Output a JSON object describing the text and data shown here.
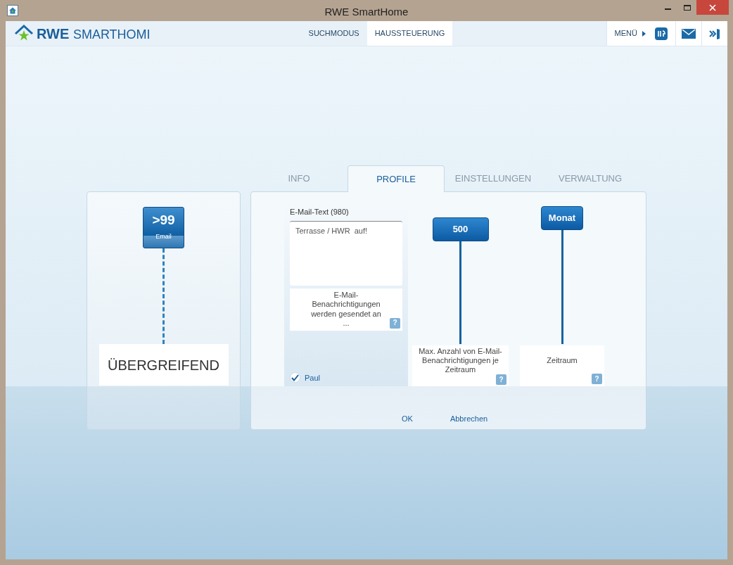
{
  "window": {
    "title": "RWE SmartHome"
  },
  "header": {
    "logo_text": {
      "bold": "RWE",
      "light": "SMARTHOMI"
    },
    "nav": [
      {
        "label": "SUCHMODUS",
        "selected": false
      },
      {
        "label": "HAUSSTEUERUNG",
        "selected": true
      }
    ],
    "menu_label": "MENÜ"
  },
  "scope_panel": {
    "badge_value": ">99",
    "badge_label": "Email",
    "scope": "ÜBERGREIFEND"
  },
  "tabs": [
    {
      "label": "INFO",
      "selected": false
    },
    {
      "label": "PROFILE",
      "selected": true
    },
    {
      "label": "EINSTELLUNGEN",
      "selected": false
    },
    {
      "label": "VERWALTUNG",
      "selected": false
    }
  ],
  "profile": {
    "email_text_label": "E-Mail-Text (980)",
    "email_text_value": "Terrasse / HWR  auf!",
    "recipients_info": {
      "text": "E-Mail-Benachrichtigungen werden gesendet an ...",
      "help": "?"
    },
    "recipients": [
      {
        "name": "Paul",
        "checked": true
      }
    ],
    "settings": [
      {
        "value": "500",
        "label": "Max. Anzahl von E-Mail-Benachrichtigungen je Zeitraum",
        "help": "?"
      },
      {
        "value": "Monat",
        "label": "Zeitraum",
        "help": "?"
      }
    ]
  },
  "buttons": [
    "OK",
    "Abbrechen"
  ]
}
